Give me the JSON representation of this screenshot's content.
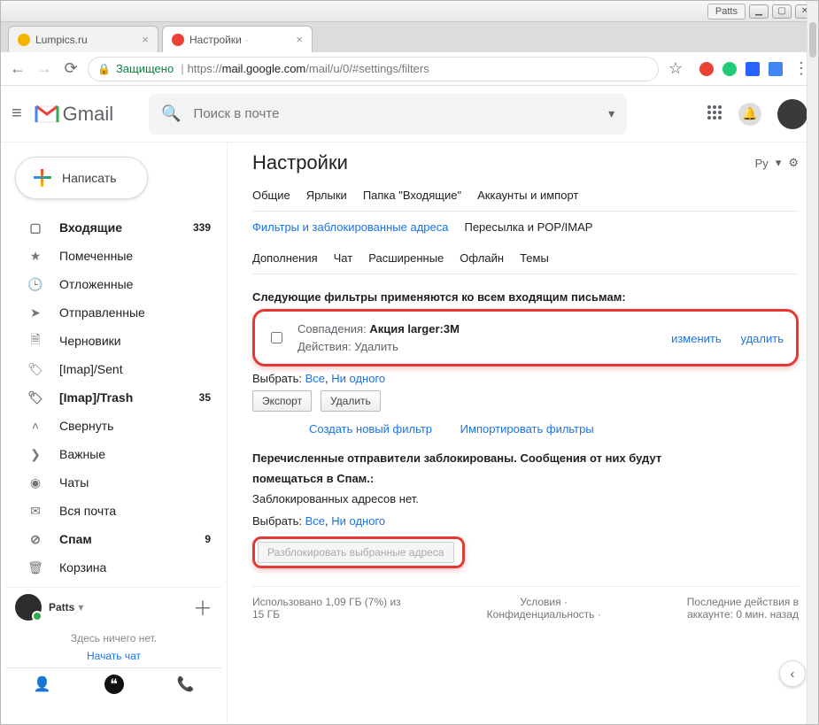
{
  "os": {
    "user_tab": "Patts",
    "min": "▁",
    "max": "▢",
    "close": "✕"
  },
  "browser": {
    "tab1": {
      "title": "Lumpics.ru"
    },
    "tab2": {
      "title": "Настройки"
    },
    "secure_label": "Защищено",
    "url_proto": "https://",
    "url_domain": "mail.google.com",
    "url_path": "/mail/u/0/#settings/filters"
  },
  "header": {
    "product": "Gmail",
    "search_placeholder": "Поиск в почте"
  },
  "compose_label": "Написать",
  "nav": {
    "inbox": {
      "label": "Входящие",
      "count": "339"
    },
    "starred": {
      "label": "Помеченные"
    },
    "snoozed": {
      "label": "Отложенные"
    },
    "sent": {
      "label": "Отправленные"
    },
    "drafts": {
      "label": "Черновики"
    },
    "imap_sent": {
      "label": "[Imap]/Sent"
    },
    "imap_trash": {
      "label": "[Imap]/Trash",
      "count": "35"
    },
    "collapse": {
      "label": "Свернуть"
    },
    "important": {
      "label": "Важные"
    },
    "chats": {
      "label": "Чаты"
    },
    "allmail": {
      "label": "Вся почта"
    },
    "spam": {
      "label": "Спам",
      "count": "9"
    },
    "bin": {
      "label": "Корзина"
    }
  },
  "chat": {
    "user": "Patts",
    "empty": "Здесь ничего нет.",
    "start": "Начать чат"
  },
  "settings": {
    "title": "Настройки",
    "lang": "Ру",
    "tabs": {
      "general": "Общие",
      "labels": "Ярлыки",
      "inbox_tab": "Папка \"Входящие\"",
      "accounts": "Аккаунты и импорт",
      "filters": "Фильтры и заблокированные адреса",
      "fwd": "Пересылка и POP/IMAP",
      "addons": "Дополнения",
      "chat_tab": "Чат",
      "advanced": "Расширенные",
      "offline": "Офлайн",
      "themes": "Темы"
    },
    "filters_heading": "Следующие фильтры применяются ко всем входящим письмам:",
    "filter": {
      "match_label": "Совпадения:",
      "match_value": "Акция larger:3M",
      "action_label": "Действия:",
      "action_value": "Удалить",
      "edit": "изменить",
      "delete": "удалить"
    },
    "select_label": "Выбрать:",
    "select_all": "Все",
    "select_none": "Ни одного",
    "export_btn": "Экспорт",
    "delete_btn": "Удалить",
    "create_filter": "Создать новый фильтр",
    "import_filters": "Импортировать фильтры",
    "blocked_heading_a": "Перечисленные отправители заблокированы. Сообщения от них будут",
    "blocked_heading_b": "помещаться в Спам.:",
    "no_blocked": "Заблокированных адресов нет.",
    "unblock_btn": "Разблокировать выбранные адреса"
  },
  "footer": {
    "storage_a": "Использовано 1,09 ГБ (7%) из",
    "storage_b": "15 ГБ",
    "terms": "Условия",
    "privacy": "Конфиденциальность",
    "activity_a": "Последние действия в",
    "activity_b": "аккаунте: 0 мин. назад"
  }
}
